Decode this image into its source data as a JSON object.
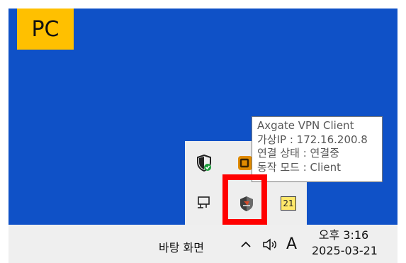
{
  "badge": {
    "label": "PC"
  },
  "tooltip": {
    "lines": [
      "Axgate VPN Client",
      "가상IP : 172.16.200.8",
      "연결 상태 : 연결중",
      "동작 모드 : Client"
    ]
  },
  "tray_icons": [
    {
      "name": "windows-security-icon"
    },
    {
      "name": "orange-app-icon"
    },
    {
      "name": "network-monitor-icon"
    },
    {
      "name": "axgate-vpn-icon"
    },
    {
      "name": "number-badge-icon",
      "label": "21"
    }
  ],
  "taskbar": {
    "show_desktop_label": "바탕 화면",
    "chevron_icon": "chevron-up-icon",
    "volume_icon": "speaker-icon",
    "ime_label": "A",
    "time": "오후 3:16",
    "date": "2025-03-21"
  },
  "colors": {
    "desktop": "#0f51c7",
    "badge": "#ffc000",
    "highlight": "#ff0000"
  }
}
